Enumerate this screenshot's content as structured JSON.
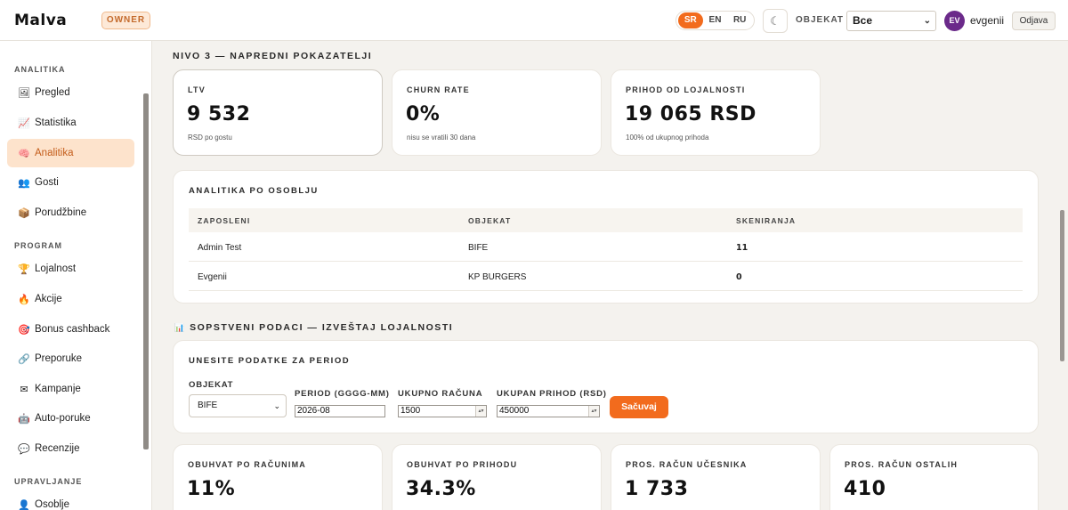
{
  "header": {
    "logo": "Malva",
    "role_badge": "OWNER",
    "languages": [
      "SR",
      "EN",
      "RU"
    ],
    "active_language": "SR",
    "theme_icon": "☾",
    "object_label": "OBJEKAT",
    "object_value": "Все",
    "avatar_initials": "EV",
    "username": "evgenii",
    "logout_label": "Odjava"
  },
  "sidebar": {
    "sections": [
      {
        "title": "ANALITIKA",
        "items": [
          {
            "label": "Pregled",
            "icon": "🖼"
          },
          {
            "label": "Statistika",
            "icon": "📈"
          },
          {
            "label": "Analitika",
            "icon": "🧠",
            "active": true
          },
          {
            "label": "Gosti",
            "icon": "👥"
          },
          {
            "label": "Porudžbine",
            "icon": "📦"
          }
        ]
      },
      {
        "title": "PROGRAM",
        "items": [
          {
            "label": "Lojalnost",
            "icon": "🏆"
          },
          {
            "label": "Akcije",
            "icon": "🔥"
          },
          {
            "label": "Bonus cashback",
            "icon": "🎯"
          },
          {
            "label": "Preporuke",
            "icon": "🔗"
          },
          {
            "label": "Kampanje",
            "icon": "✉"
          },
          {
            "label": "Auto-poruke",
            "icon": "🤖"
          },
          {
            "label": "Recenzije",
            "icon": "💬"
          }
        ]
      },
      {
        "title": "UPRAVLJANJE",
        "items": [
          {
            "label": "Osoblje",
            "icon": "👤"
          }
        ]
      }
    ]
  },
  "main": {
    "level3_title": "NIVO 3 — NAPREDNI POKAZATELJI",
    "kpis": [
      {
        "label": "LTV",
        "value": "9 532",
        "sub": "RSD po gostu"
      },
      {
        "label": "CHURN RATE",
        "value": "0%",
        "sub": "nisu se vratili 30 dana"
      },
      {
        "label": "PRIHOD OD LOJALNOSTI",
        "value": "19 065 RSD",
        "sub": "100% od ukupnog prihoda"
      }
    ],
    "staff": {
      "title": "ANALITIKA PO OSOBLJU",
      "columns": [
        "ZAPOSLENI",
        "OBJEKAT",
        "SKENIRANJA"
      ],
      "rows": [
        [
          "Admin Test",
          "BIFE",
          "11"
        ],
        [
          "Evgenii",
          "KP BURGERS",
          "0"
        ]
      ]
    },
    "report": {
      "icon": "📊",
      "title": "SOPSTVENI PODACI — IZVEŠTAJ LOJALNOSTI",
      "form_title": "UNESITE PODATKE ZA PERIOD",
      "object_label": "OBJEKAT",
      "object_value": "BIFE",
      "period_label": "PERIOD (GGGG-MM)",
      "period_value": "2026-08",
      "receipts_label": "UKUPNO RAČUNA",
      "receipts_value": "1500",
      "revenue_label": "UKUPAN PRIHOD (RSD)",
      "revenue_value": "450000",
      "save_label": "Sačuvaj"
    },
    "bottom_kpis": [
      {
        "label": "OBUHVAT PO RAČUNIMA",
        "value": "11%"
      },
      {
        "label": "OBUHVAT PO PRIHODU",
        "value": "34.3%"
      },
      {
        "label": "PROS. RAČUN UČESNIKA",
        "value": "1 733"
      },
      {
        "label": "PROS. RAČUN OSTALIH",
        "value": "410"
      }
    ]
  }
}
